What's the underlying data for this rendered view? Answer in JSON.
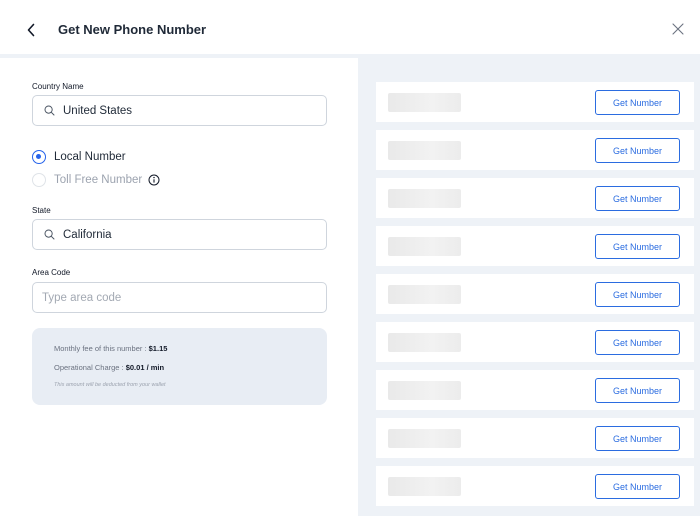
{
  "header": {
    "title": "Get New Phone Number",
    "back_icon": "chevron-left-icon",
    "close_icon": "close-icon"
  },
  "form": {
    "country": {
      "label": "Country Name",
      "value": "United States",
      "icon": "search-icon"
    },
    "number_type": [
      {
        "label": "Local Number",
        "selected": true
      },
      {
        "label": "Toll Free Number",
        "selected": false,
        "disabled": true,
        "icon": "info-icon"
      }
    ],
    "state": {
      "label": "State",
      "value": "California",
      "icon": "search-icon"
    },
    "area_code": {
      "label": "Area Code",
      "placeholder": "Type area code"
    }
  },
  "fees": {
    "monthly_label": "Monthly fee of this number :",
    "monthly_value": "$1.15",
    "operational_label": "Operational Charge :",
    "operational_value": "$0.01 / min",
    "note": "This amount will be deducted from your wallet"
  },
  "numbers": [
    {
      "button_label": "Get Number"
    },
    {
      "button_label": "Get Number"
    },
    {
      "button_label": "Get Number"
    },
    {
      "button_label": "Get Number"
    },
    {
      "button_label": "Get Number"
    },
    {
      "button_label": "Get Number"
    },
    {
      "button_label": "Get Number"
    },
    {
      "button_label": "Get Number"
    },
    {
      "button_label": "Get Number"
    }
  ],
  "colors": {
    "accent": "#2b6ce0",
    "panel_bg": "#eef2f7",
    "fee_card_bg": "#e8edf4"
  }
}
